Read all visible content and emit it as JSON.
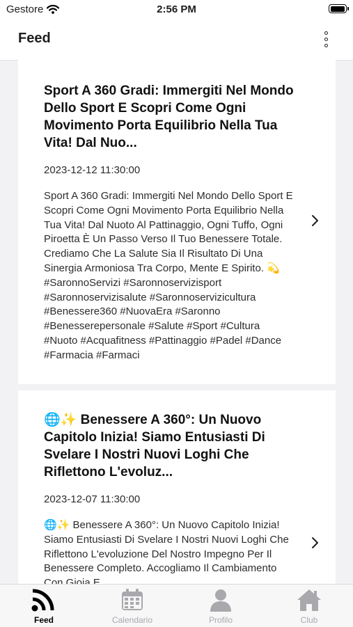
{
  "status": {
    "carrier": "Gestore",
    "time": "2:56 PM"
  },
  "nav": {
    "title": "Feed"
  },
  "posts": [
    {
      "title": "Sport A 360 Gradi: Immergiti Nel Mondo Dello Sport E Scopri Come Ogni Movimento Porta Equilibrio Nella Tua Vita! Dal Nuo...",
      "date": "2023-12-12 11:30:00",
      "body": "Sport A 360 Gradi: Immergiti Nel Mondo Dello Sport E Scopri Come Ogni Movimento Porta Equilibrio Nella Tua Vita! Dal Nuoto Al Pattinaggio, Ogni Tuffo, Ogni Piroetta È Un Passo Verso Il Tuo Benessere Totale. Crediamo Che La Salute Sia Il Risultato Di Una Sinergia Armoniosa Tra Corpo, Mente E Spirito. 💫 #SaronnoServizi #Saronnoservizisport #Saronnoservizisalute #Saronnoservizicultura #Benessere360 #NuovaEra #Saronno #Benesserepersonale #Salute #Sport #Cultura #Nuoto #Acquafitness #Pattinaggio #Padel #Dance #Farmacia #Farmaci"
    },
    {
      "title": "🌐✨ Benessere A 360°: Un Nuovo Capitolo Inizia! Siamo Entusiasti Di Svelare I Nostri Nuovi Loghi Che Riflettono L'evoluz...",
      "date": "2023-12-07 11:30:00",
      "body": "🌐✨ Benessere A 360°: Un Nuovo Capitolo Inizia! Siamo Entusiasti Di Svelare I Nostri Nuovi Loghi Che Riflettono L'evoluzione Del Nostro Impegno Per Il Benessere Completo. Accogliamo Il Cambiamento Con Gioia E"
    }
  ],
  "tabs": [
    {
      "label": "Feed",
      "icon": "feed-icon",
      "active": true
    },
    {
      "label": "Calendario",
      "icon": "calendar-icon",
      "active": false
    },
    {
      "label": "Profilo",
      "icon": "profile-icon",
      "active": false
    },
    {
      "label": "Club",
      "icon": "home-icon",
      "active": false
    }
  ],
  "colors": {
    "active_tab": "#000000",
    "inactive_tab": "#a9a9ad",
    "background": "#f2f2f4"
  }
}
